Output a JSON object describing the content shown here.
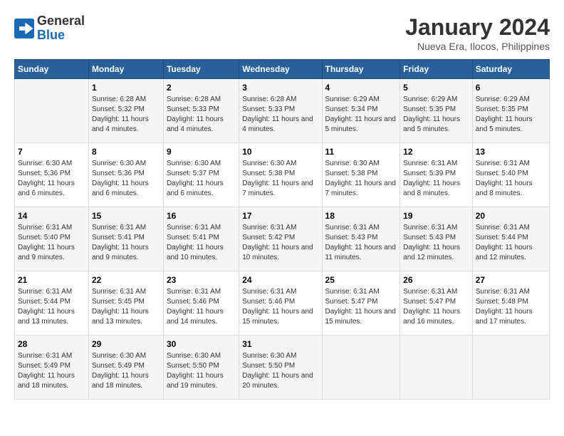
{
  "logo": {
    "text_general": "General",
    "text_blue": "Blue"
  },
  "title": "January 2024",
  "subtitle": "Nueva Era, Ilocos, Philippines",
  "weekdays": [
    "Sunday",
    "Monday",
    "Tuesday",
    "Wednesday",
    "Thursday",
    "Friday",
    "Saturday"
  ],
  "days": [
    {
      "num": "",
      "sunrise": "",
      "sunset": "",
      "daylight": ""
    },
    {
      "num": "1",
      "sunrise": "Sunrise: 6:28 AM",
      "sunset": "Sunset: 5:32 PM",
      "daylight": "Daylight: 11 hours and 4 minutes."
    },
    {
      "num": "2",
      "sunrise": "Sunrise: 6:28 AM",
      "sunset": "Sunset: 5:33 PM",
      "daylight": "Daylight: 11 hours and 4 minutes."
    },
    {
      "num": "3",
      "sunrise": "Sunrise: 6:28 AM",
      "sunset": "Sunset: 5:33 PM",
      "daylight": "Daylight: 11 hours and 4 minutes."
    },
    {
      "num": "4",
      "sunrise": "Sunrise: 6:29 AM",
      "sunset": "Sunset: 5:34 PM",
      "daylight": "Daylight: 11 hours and 5 minutes."
    },
    {
      "num": "5",
      "sunrise": "Sunrise: 6:29 AM",
      "sunset": "Sunset: 5:35 PM",
      "daylight": "Daylight: 11 hours and 5 minutes."
    },
    {
      "num": "6",
      "sunrise": "Sunrise: 6:29 AM",
      "sunset": "Sunset: 5:35 PM",
      "daylight": "Daylight: 11 hours and 5 minutes."
    },
    {
      "num": "7",
      "sunrise": "Sunrise: 6:30 AM",
      "sunset": "Sunset: 5:36 PM",
      "daylight": "Daylight: 11 hours and 6 minutes."
    },
    {
      "num": "8",
      "sunrise": "Sunrise: 6:30 AM",
      "sunset": "Sunset: 5:36 PM",
      "daylight": "Daylight: 11 hours and 6 minutes."
    },
    {
      "num": "9",
      "sunrise": "Sunrise: 6:30 AM",
      "sunset": "Sunset: 5:37 PM",
      "daylight": "Daylight: 11 hours and 6 minutes."
    },
    {
      "num": "10",
      "sunrise": "Sunrise: 6:30 AM",
      "sunset": "Sunset: 5:38 PM",
      "daylight": "Daylight: 11 hours and 7 minutes."
    },
    {
      "num": "11",
      "sunrise": "Sunrise: 6:30 AM",
      "sunset": "Sunset: 5:38 PM",
      "daylight": "Daylight: 11 hours and 7 minutes."
    },
    {
      "num": "12",
      "sunrise": "Sunrise: 6:31 AM",
      "sunset": "Sunset: 5:39 PM",
      "daylight": "Daylight: 11 hours and 8 minutes."
    },
    {
      "num": "13",
      "sunrise": "Sunrise: 6:31 AM",
      "sunset": "Sunset: 5:40 PM",
      "daylight": "Daylight: 11 hours and 8 minutes."
    },
    {
      "num": "14",
      "sunrise": "Sunrise: 6:31 AM",
      "sunset": "Sunset: 5:40 PM",
      "daylight": "Daylight: 11 hours and 9 minutes."
    },
    {
      "num": "15",
      "sunrise": "Sunrise: 6:31 AM",
      "sunset": "Sunset: 5:41 PM",
      "daylight": "Daylight: 11 hours and 9 minutes."
    },
    {
      "num": "16",
      "sunrise": "Sunrise: 6:31 AM",
      "sunset": "Sunset: 5:41 PM",
      "daylight": "Daylight: 11 hours and 10 minutes."
    },
    {
      "num": "17",
      "sunrise": "Sunrise: 6:31 AM",
      "sunset": "Sunset: 5:42 PM",
      "daylight": "Daylight: 11 hours and 10 minutes."
    },
    {
      "num": "18",
      "sunrise": "Sunrise: 6:31 AM",
      "sunset": "Sunset: 5:43 PM",
      "daylight": "Daylight: 11 hours and 11 minutes."
    },
    {
      "num": "19",
      "sunrise": "Sunrise: 6:31 AM",
      "sunset": "Sunset: 5:43 PM",
      "daylight": "Daylight: 11 hours and 12 minutes."
    },
    {
      "num": "20",
      "sunrise": "Sunrise: 6:31 AM",
      "sunset": "Sunset: 5:44 PM",
      "daylight": "Daylight: 11 hours and 12 minutes."
    },
    {
      "num": "21",
      "sunrise": "Sunrise: 6:31 AM",
      "sunset": "Sunset: 5:44 PM",
      "daylight": "Daylight: 11 hours and 13 minutes."
    },
    {
      "num": "22",
      "sunrise": "Sunrise: 6:31 AM",
      "sunset": "Sunset: 5:45 PM",
      "daylight": "Daylight: 11 hours and 13 minutes."
    },
    {
      "num": "23",
      "sunrise": "Sunrise: 6:31 AM",
      "sunset": "Sunset: 5:46 PM",
      "daylight": "Daylight: 11 hours and 14 minutes."
    },
    {
      "num": "24",
      "sunrise": "Sunrise: 6:31 AM",
      "sunset": "Sunset: 5:46 PM",
      "daylight": "Daylight: 11 hours and 15 minutes."
    },
    {
      "num": "25",
      "sunrise": "Sunrise: 6:31 AM",
      "sunset": "Sunset: 5:47 PM",
      "daylight": "Daylight: 11 hours and 15 minutes."
    },
    {
      "num": "26",
      "sunrise": "Sunrise: 6:31 AM",
      "sunset": "Sunset: 5:47 PM",
      "daylight": "Daylight: 11 hours and 16 minutes."
    },
    {
      "num": "27",
      "sunrise": "Sunrise: 6:31 AM",
      "sunset": "Sunset: 5:48 PM",
      "daylight": "Daylight: 11 hours and 17 minutes."
    },
    {
      "num": "28",
      "sunrise": "Sunrise: 6:31 AM",
      "sunset": "Sunset: 5:49 PM",
      "daylight": "Daylight: 11 hours and 18 minutes."
    },
    {
      "num": "29",
      "sunrise": "Sunrise: 6:30 AM",
      "sunset": "Sunset: 5:49 PM",
      "daylight": "Daylight: 11 hours and 18 minutes."
    },
    {
      "num": "30",
      "sunrise": "Sunrise: 6:30 AM",
      "sunset": "Sunset: 5:50 PM",
      "daylight": "Daylight: 11 hours and 19 minutes."
    },
    {
      "num": "31",
      "sunrise": "Sunrise: 6:30 AM",
      "sunset": "Sunset: 5:50 PM",
      "daylight": "Daylight: 11 hours and 20 minutes."
    }
  ]
}
